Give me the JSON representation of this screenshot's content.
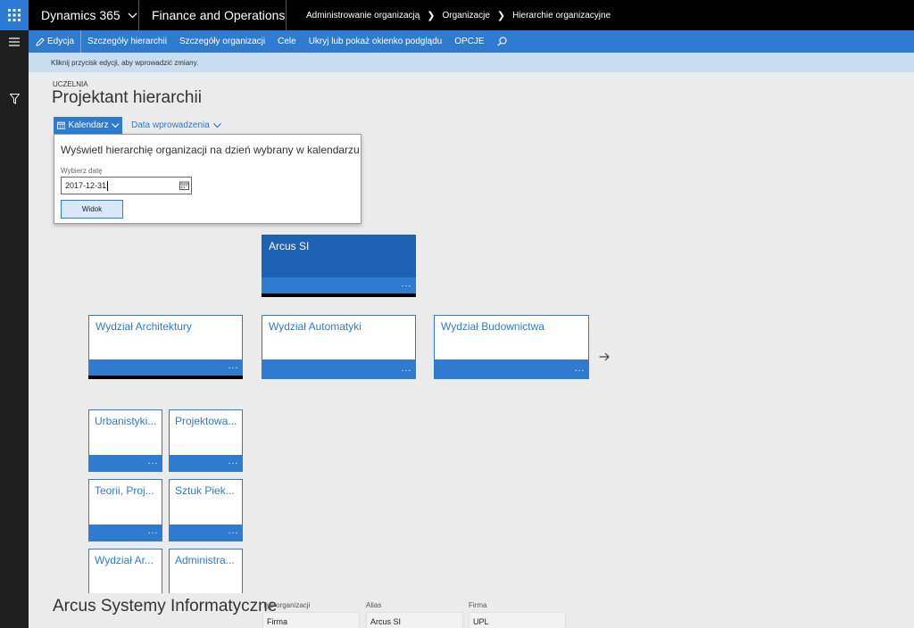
{
  "topbar": {
    "product": "Dynamics 365",
    "app": "Finance and Operations",
    "breadcrumbs": [
      "Administrowanie organizacją",
      "Organizacje",
      "Hierarchie organizacyjne"
    ]
  },
  "actionpane": {
    "edit": "Edycja",
    "hierarchy_details": "Szczegóły hierarchii",
    "org_details": "Szczegóły organizacji",
    "goals": "Cele",
    "toggle_preview": "Ukryj lub pokaż okienko podglądu",
    "options": "OPCJE"
  },
  "message": "Kliknij przycisk edycji, aby wprowadzić zmiany.",
  "header": {
    "entity": "UCZELNIA",
    "title": "Projektant hierarchii"
  },
  "tabs": {
    "calendar": "Kalendarz",
    "entry_date": "Data wprowadzenia"
  },
  "flyout": {
    "description": "Wyświetl hierarchię organizacji na dzień wybrany w kalendarzu",
    "date_label": "Wybierz datę",
    "date_value": "2017-12-31",
    "view_button": "Widok"
  },
  "hierarchy": {
    "root": {
      "name": "Arcus SI",
      "more": "···"
    },
    "level1": [
      {
        "name": "Wydział Architektury",
        "more": "···"
      },
      {
        "name": "Wydział Automatyki",
        "more": "···"
      },
      {
        "name": "Wydział Budownictwa",
        "more": "···"
      }
    ],
    "level2": [
      {
        "name": "Urbanistyki...",
        "more": "···"
      },
      {
        "name": "Projektowa...",
        "more": "···"
      },
      {
        "name": "Teorii, Proj...",
        "more": "···"
      },
      {
        "name": "Sztuk Piek...",
        "more": "···"
      },
      {
        "name": "Wydział Ar...",
        "more": "···"
      },
      {
        "name": "Administra...",
        "more": "···"
      }
    ]
  },
  "details": {
    "title": "Arcus Systemy Informatyczne",
    "fields": [
      {
        "label": "Typ organizacji",
        "value": "Firma"
      },
      {
        "label": "Alias",
        "value": "Arcus SI"
      },
      {
        "label": "Firma",
        "value": "UPL"
      }
    ]
  },
  "colors": {
    "accent": "#2e7bcf",
    "selected": "#1e62b3",
    "message_bg": "#c8dff3"
  }
}
